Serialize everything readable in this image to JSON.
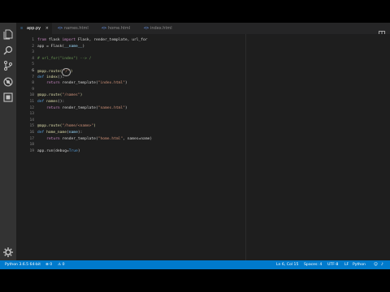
{
  "tabs": [
    {
      "label": "app.py",
      "icon": "py-icon",
      "active": true,
      "close": "×"
    },
    {
      "label": "names.html",
      "icon": "html-icon",
      "active": false
    },
    {
      "label": "home.html",
      "icon": "html-icon",
      "active": false
    },
    {
      "label": "index.html",
      "icon": "html-icon",
      "active": false
    }
  ],
  "editor": {
    "lines": [
      {
        "n": "1",
        "parts": [
          [
            "kw",
            "from"
          ],
          [
            "p",
            " flask "
          ],
          [
            "kw",
            "import"
          ],
          [
            "p",
            " Flask, render_template, url_for"
          ]
        ]
      },
      {
        "n": "2",
        "parts": [
          [
            "p",
            "app = Flask("
          ],
          [
            "var",
            "__name__"
          ],
          [
            "p",
            ")"
          ]
        ]
      },
      {
        "n": "3",
        "parts": []
      },
      {
        "n": "4",
        "parts": [
          [
            "cm",
            "# url_for(\"index\") --> /"
          ]
        ]
      },
      {
        "n": "5",
        "parts": []
      },
      {
        "n": "6",
        "parts": [
          [
            "dec",
            "@app.route("
          ],
          [
            "str",
            "\"/\""
          ],
          [
            "dec",
            ")"
          ]
        ],
        "current": true
      },
      {
        "n": "7",
        "parts": [
          [
            "kw2",
            "def"
          ],
          [
            "fn",
            " index"
          ],
          [
            "p",
            "():"
          ]
        ]
      },
      {
        "n": "8",
        "parts": [
          [
            "p",
            "    "
          ],
          [
            "kw",
            "return"
          ],
          [
            "p",
            " render_template("
          ],
          [
            "str",
            "\"index.html\""
          ],
          [
            "p",
            ")"
          ]
        ]
      },
      {
        "n": "9",
        "parts": []
      },
      {
        "n": "10",
        "parts": [
          [
            "dec",
            "@app.route("
          ],
          [
            "str",
            "\"/names\""
          ],
          [
            "dec",
            ")"
          ]
        ]
      },
      {
        "n": "11",
        "parts": [
          [
            "kw2",
            "def"
          ],
          [
            "fn",
            " names"
          ],
          [
            "p",
            "():"
          ]
        ]
      },
      {
        "n": "12",
        "parts": [
          [
            "p",
            "    "
          ],
          [
            "kw",
            "return"
          ],
          [
            "p",
            " render_template("
          ],
          [
            "str",
            "\"names.html\""
          ],
          [
            "p",
            ")"
          ]
        ]
      },
      {
        "n": "13",
        "parts": []
      },
      {
        "n": "14",
        "parts": []
      },
      {
        "n": "15",
        "parts": [
          [
            "dec",
            "@app.route("
          ],
          [
            "str",
            "\"/home/<name>\""
          ],
          [
            "dec",
            ")"
          ]
        ]
      },
      {
        "n": "16",
        "parts": [
          [
            "kw2",
            "def"
          ],
          [
            "fn",
            " home_name"
          ],
          [
            "p",
            "("
          ],
          [
            "var",
            "name"
          ],
          [
            "p",
            "):"
          ]
        ]
      },
      {
        "n": "17",
        "parts": [
          [
            "p",
            "    "
          ],
          [
            "kw",
            "return"
          ],
          [
            "p",
            " render_template("
          ],
          [
            "str",
            "\"home.html\""
          ],
          [
            "p",
            ", names=name)"
          ]
        ]
      },
      {
        "n": "18",
        "parts": []
      },
      {
        "n": "19",
        "parts": [
          [
            "p",
            "app.run(debug="
          ],
          [
            "kw2",
            "True"
          ],
          [
            "p",
            ")"
          ]
        ]
      }
    ]
  },
  "status": {
    "interpreter": "Python 3.6.5 64-bit",
    "errors": "⊗ 0",
    "warnings": "⚠ 0",
    "position": "Ln 6, Col 15",
    "spaces": "Spaces: 4",
    "encoding": "UTF-8",
    "eol": "LF",
    "language": "Python"
  },
  "colors": {
    "statusbar": "#007acc",
    "editor_bg": "#1e1e1e",
    "activity_bg": "#333333"
  },
  "activity_icons": [
    "files-icon",
    "search-icon",
    "source-control-icon",
    "debug-icon",
    "extensions-icon",
    "gear-icon"
  ]
}
